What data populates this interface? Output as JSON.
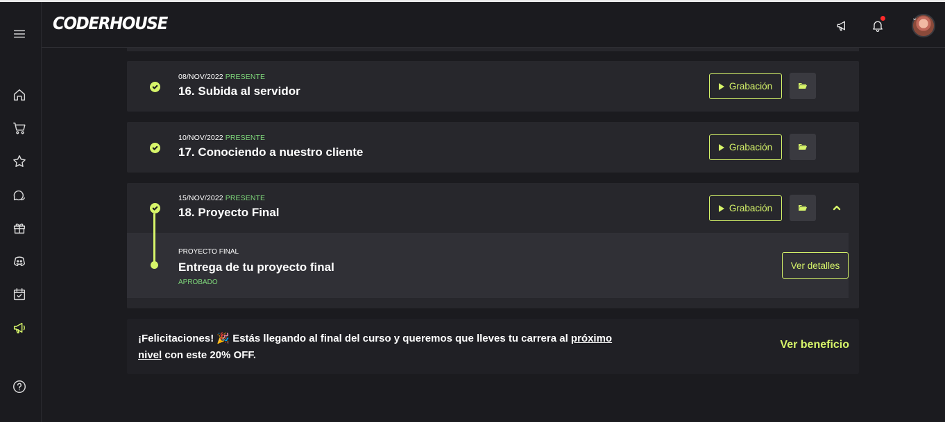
{
  "app": {
    "logo": "CODERHOUSE"
  },
  "sidebar": {
    "items": [
      {
        "icon": "menu-icon"
      },
      {
        "icon": "home-icon"
      },
      {
        "icon": "cart-icon"
      },
      {
        "icon": "star-icon"
      },
      {
        "icon": "chat-icon"
      },
      {
        "icon": "gift-icon"
      },
      {
        "icon": "discord-icon"
      },
      {
        "icon": "calendar-check-icon"
      },
      {
        "icon": "megaphone-icon",
        "active": true
      },
      {
        "icon": "help-icon"
      }
    ]
  },
  "header": {
    "icons": [
      "megaphone-icon",
      "bell-icon"
    ],
    "notification_color": "#ff2a2a"
  },
  "classes": [
    {
      "date": "08/NOV/2022",
      "status": "PRESENTE",
      "title": "16. Subida al servidor",
      "recording_label": "Grabación"
    },
    {
      "date": "10/NOV/2022",
      "status": "PRESENTE",
      "title": "17. Conociendo a nuestro cliente",
      "recording_label": "Grabación"
    },
    {
      "date": "15/NOV/2022",
      "status": "PRESENTE",
      "title": "18. Proyecto Final",
      "recording_label": "Grabación",
      "expanded": true,
      "deliverable": {
        "label": "PROYECTO FINAL",
        "title": "Entrega de tu proyecto final",
        "status": "APROBADO",
        "button_label": "Ver detalles"
      }
    }
  ],
  "promo": {
    "text_before": "¡Felicitaciones! 🎉 Estás llegando al final del curso y queremos que lleves tu carrera al ",
    "link_text": "próximo nivel",
    "text_after": " con este 20% OFF.",
    "cta_label": "Ver beneficio"
  },
  "colors": {
    "accent": "#d7f56a",
    "status_green": "#7ed67a",
    "background": "#1b1b1f",
    "card": "#27272c"
  }
}
